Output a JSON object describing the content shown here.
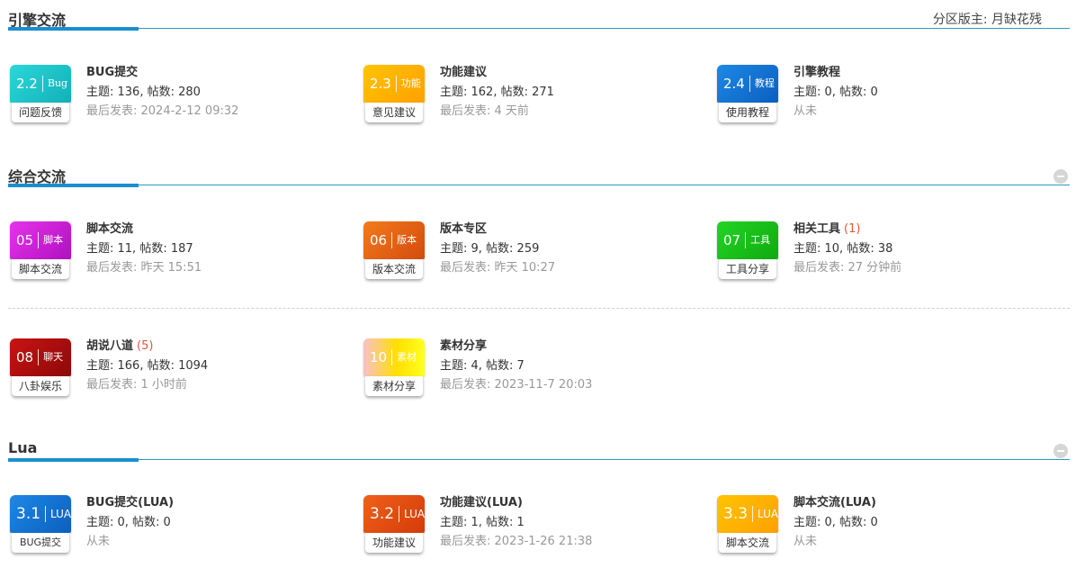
{
  "sections": [
    {
      "title": "引擎交流",
      "moderator": "分区版主: 月缺花残",
      "forums": [
        {
          "num": "2.2",
          "kind": "Bug",
          "sub": "问题反馈",
          "name": "BUG提交",
          "new": "",
          "stats": "主题: 136, 帖数: 280",
          "last": "最后发表: 2024-2-12 09:32",
          "color": "#20c6c6"
        },
        {
          "num": "2.3",
          "kind": "功能",
          "sub": "意见建议",
          "name": "功能建议",
          "new": "",
          "stats": "主题: 162, 帖数: 271",
          "last": "最后发表: 4 天前",
          "color": "#ffb400"
        },
        {
          "num": "2.4",
          "kind": "教程",
          "sub": "使用教程",
          "name": "引擎教程",
          "new": "",
          "stats": "主题: 0, 帖数: 0",
          "last": "从未",
          "color": "#1478d4"
        }
      ]
    },
    {
      "title": "综合交流",
      "forums": [
        {
          "num": "05",
          "kind": "脚本",
          "sub": "脚本交流",
          "name": "脚本交流",
          "new": "",
          "stats": "主题: 11, 帖数: 187",
          "last": "最后发表: 昨天 15:51",
          "color": "#d21fd6"
        },
        {
          "num": "06",
          "kind": "版本",
          "sub": "版本交流",
          "name": "版本专区",
          "new": "",
          "stats": "主题: 9, 帖数: 259",
          "last": "最后发表: 昨天 10:27",
          "color": "#ee6616"
        },
        {
          "num": "07",
          "kind": "工具",
          "sub": "工具分享",
          "name": "相关工具",
          "new": "(1)",
          "stats": "主题: 10, 帖数: 38",
          "last": "最后发表: 27 分钟前",
          "color": "#19c41b"
        },
        {
          "num": "08",
          "kind": "聊天",
          "sub": "八卦娱乐",
          "name": "胡说八道",
          "new": "(5)",
          "stats": "主题: 166, 帖数: 1094",
          "last": "最后发表: 1 小时前",
          "color": "#b30d0d"
        },
        {
          "num": "10",
          "kind": "素材",
          "sub": "素材分享",
          "name": "素材分享",
          "new": "",
          "stats": "主题: 4, 帖数: 7",
          "last": "最后发表: 2023-11-7 20:03",
          "color": "#ffd400"
        }
      ]
    },
    {
      "title": "Lua",
      "forums": [
        {
          "num": "3.1",
          "kind": "LUA",
          "sub": "BUG提交",
          "name": "BUG提交(LUA)",
          "new": "",
          "stats": "主题: 0, 帖数: 0",
          "last": "从未",
          "color": "#1478d4"
        },
        {
          "num": "3.2",
          "kind": "LUA",
          "sub": "功能建议",
          "name": "功能建议(LUA)",
          "new": "",
          "stats": "主题: 1, 帖数: 1",
          "last": "最后发表: 2023-1-26 21:38",
          "color": "#e85010"
        },
        {
          "num": "3.3",
          "kind": "LUA",
          "sub": "脚本交流",
          "name": "脚本交流(LUA)",
          "new": "",
          "stats": "主题: 0, 帖数: 0",
          "last": "从未",
          "color": "#ffb400"
        }
      ]
    }
  ]
}
